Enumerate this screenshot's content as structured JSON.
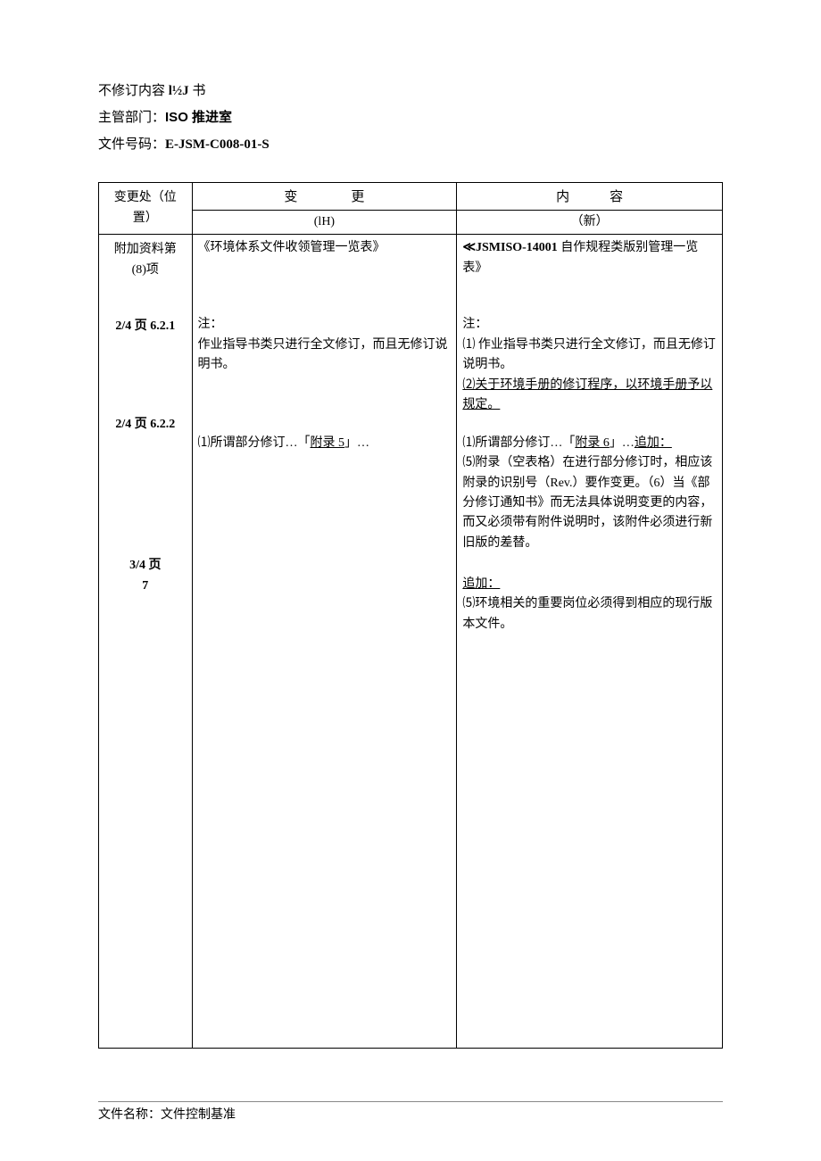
{
  "header": {
    "line1_prefix": "不修订内容 ",
    "line1_code": "l½J",
    "line1_suffix": " 书",
    "line2_label": "主管部门：",
    "line2_value": "ISO 推进室",
    "line3_label": "文件号码：",
    "line3_value": "E-JSM-C008-01-S"
  },
  "table_headers": {
    "location": "变更处（位\n置）",
    "change_label": "变更",
    "content_label": "内容",
    "old_label": "(lH)",
    "new_label": "（新）"
  },
  "rows": [
    {
      "location_a": "附加资料第",
      "location_b": "(8)项",
      "old_html": "《环境体系文件收领管理一览表》",
      "new_prefix": "≪JSMISO-14001 自作规程类版别管理一览表》"
    },
    {
      "location_a": "2/4 页 6.2.1",
      "old_html": "注：\n作业指导书类只进行全文修订，而且无修订说明书。",
      "new_prefix": "注：",
      "new_body": "⑴ 作业指导书类只进行全文修订，而且无修订说明书。",
      "new_underlined": "⑵关于环境手册的修订程序，以环境手册予以规定。"
    },
    {
      "location_a": "2/4 页 6.2.2",
      "old_line_prefix": "⑴所谓部分修订…「",
      "old_line_u": "附录 5",
      "old_line_suffix": "」…",
      "new_line_prefix": "⑴所谓部分修订…「",
      "new_line_u1": "附录 6",
      "new_line_mid": "」…",
      "new_line_u2": "追加：",
      "new_body": "⑸附录（空表格）在进行部分修订时，相应该附录的识别号（Rev.）要作变更。（6）当《部分修订通知书》而无法具体说明变更的内容，而又必须带有附件说明时，该附件必须进行新旧版的差替。"
    },
    {
      "location_a": "3/4 页",
      "location_b": "7",
      "new_line_u": "追加：",
      "new_body": "⑸环境相关的重要岗位必须得到相应的现行版本文件。"
    }
  ],
  "footer": {
    "label": "文件名称：",
    "value": "文件控制基准"
  }
}
